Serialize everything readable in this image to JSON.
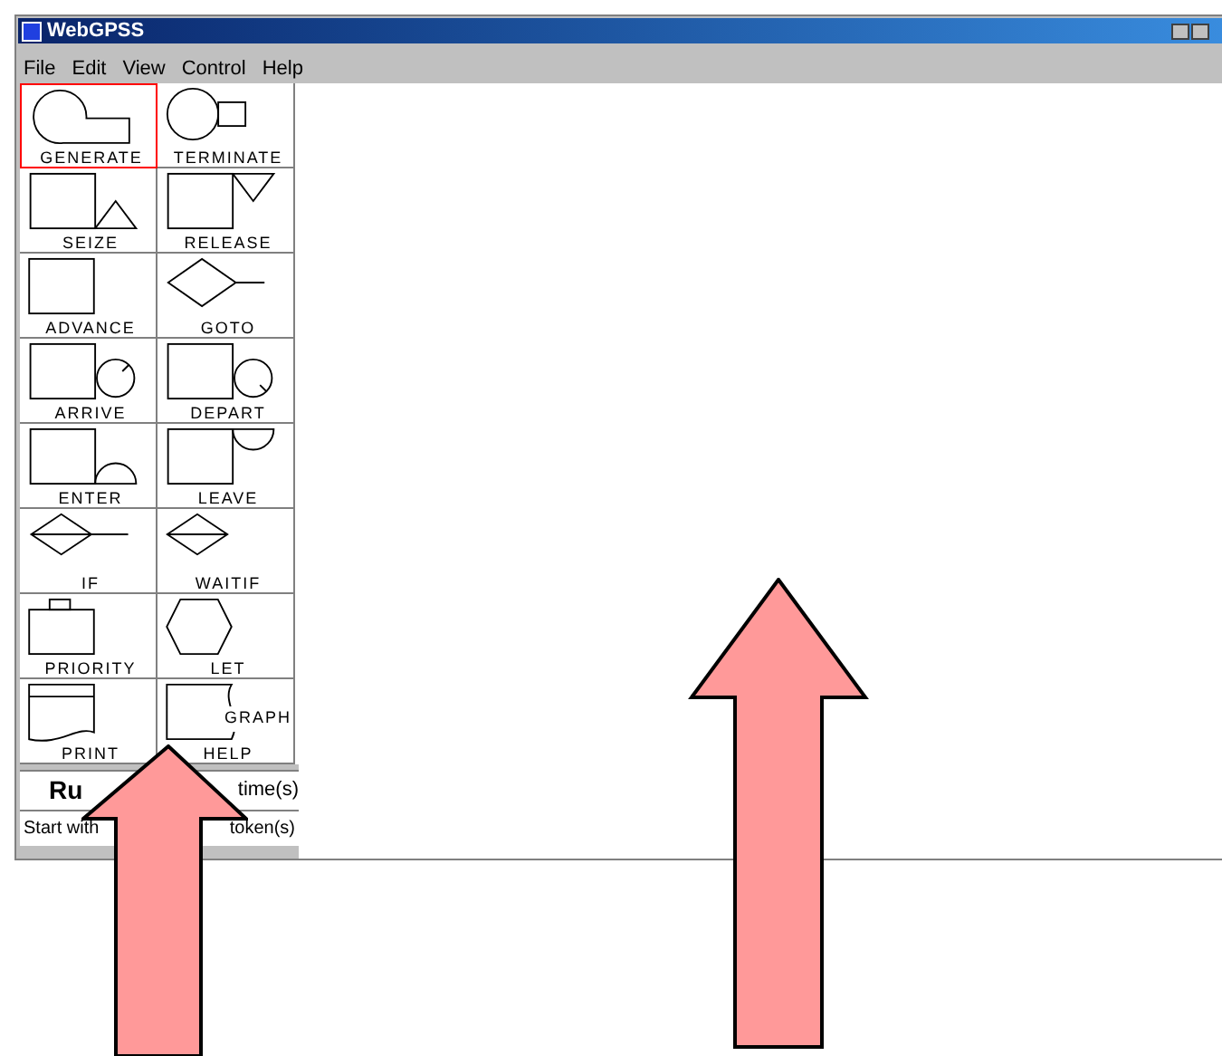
{
  "window": {
    "title": "WebGPSS"
  },
  "menu": [
    "File",
    "Edit",
    "View",
    "Control",
    "Help"
  ],
  "blocks": [
    {
      "kind": "generate",
      "label": "GENERATE",
      "selected": true
    },
    {
      "kind": "terminate",
      "label": "TERMINATE",
      "selected": false
    },
    {
      "kind": "seize",
      "label": "SEIZE",
      "selected": false
    },
    {
      "kind": "release",
      "label": "RELEASE",
      "selected": false
    },
    {
      "kind": "advance",
      "label": "ADVANCE",
      "selected": false
    },
    {
      "kind": "goto",
      "label": "GOTO",
      "selected": false
    },
    {
      "kind": "arrive",
      "label": "ARRIVE",
      "selected": false
    },
    {
      "kind": "depart",
      "label": "DEPART",
      "selected": false
    },
    {
      "kind": "enter",
      "label": "ENTER",
      "selected": false
    },
    {
      "kind": "leave",
      "label": "LEAVE",
      "selected": false
    },
    {
      "kind": "if",
      "label": "IF",
      "selected": false
    },
    {
      "kind": "waitif",
      "label": "WAITIF",
      "selected": false
    },
    {
      "kind": "priority",
      "label": "PRIORITY",
      "selected": false
    },
    {
      "kind": "let",
      "label": "LET",
      "selected": false
    },
    {
      "kind": "print",
      "label": "PRINT",
      "selected": false
    },
    {
      "kind": "help",
      "label": "HELP",
      "overlay_text": "GRAPH",
      "selected": false
    }
  ],
  "run": {
    "button": "Ru",
    "times": "time(s)"
  },
  "start": {
    "prefix": "Start with",
    "suffix": "token(s)"
  }
}
